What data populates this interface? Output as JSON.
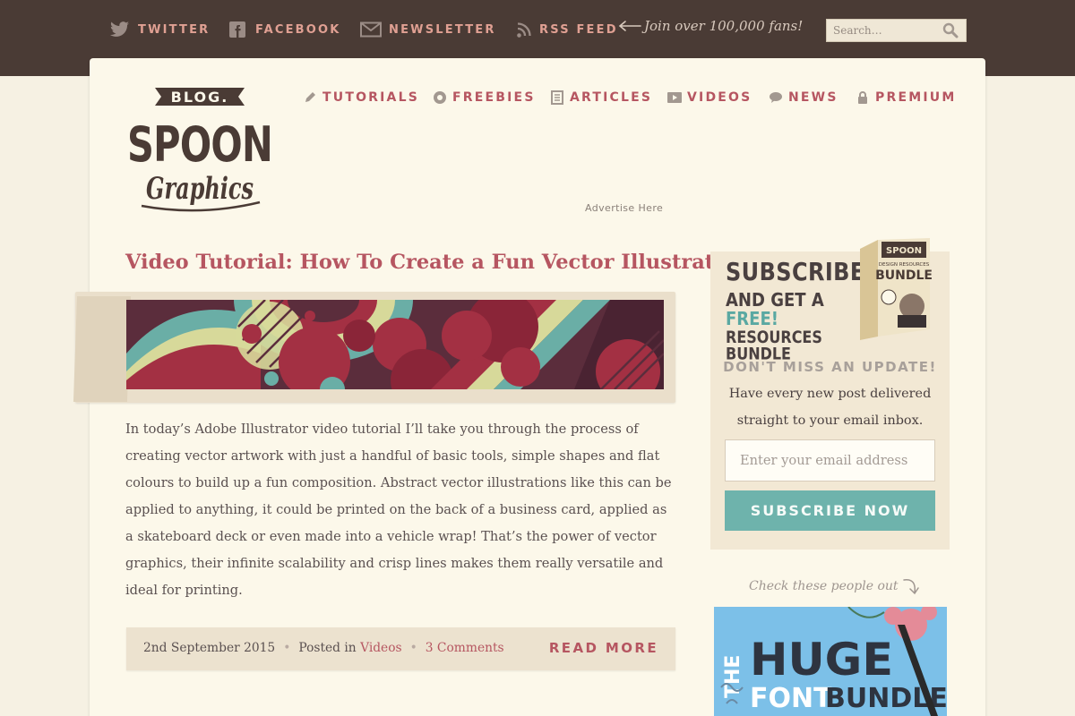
{
  "topbar": {
    "social": [
      {
        "label": "TWITTER",
        "icon": "twitter-icon"
      },
      {
        "label": "FACEBOOK",
        "icon": "facebook-icon"
      },
      {
        "label": "NEWSLETTER",
        "icon": "envelope-icon"
      },
      {
        "label": "RSS FEED",
        "icon": "rss-icon"
      }
    ],
    "fans_note": "Join over 100,000 fans!",
    "search": {
      "placeholder": "Search…"
    }
  },
  "logo": {
    "top": "BLOG.",
    "middle": "SPOON",
    "bottom": "Graphics"
  },
  "nav": [
    {
      "label": "TUTORIALS",
      "icon": "pencil-icon"
    },
    {
      "label": "FREEBIES",
      "icon": "gift-icon"
    },
    {
      "label": "ARTICLES",
      "icon": "document-icon"
    },
    {
      "label": "VIDEOS",
      "icon": "video-icon"
    },
    {
      "label": "NEWS",
      "icon": "speech-bubble-icon"
    },
    {
      "label": "PREMIUM",
      "icon": "lock-icon"
    }
  ],
  "advertise": "Advertise Here",
  "post": {
    "title": "Video Tutorial: How To Create a Fun Vector Illustration",
    "body": "In today’s Adobe Illustrator video tutorial I’ll take you through the process of creating vector artwork with just a handful of basic tools, simple shapes and flat colours to build up a fun composition. Abstract vector illustrations like this can be applied to anything, it could be printed on the back of a business card, applied as a skateboard deck or even made into a vehicle wrap! That’s the power of vector graphics, their infinite scalability and crisp lines makes them really versatile and ideal for printing.",
    "date": "2nd September 2015",
    "posted_in_label": "Posted in",
    "category": "Videos",
    "comments": "3 Comments",
    "read_more": "READ MORE"
  },
  "sidebar": {
    "headline_1": "SUBSCRIBE",
    "headline_2a": "AND GET A ",
    "headline_2b": "FREE!",
    "headline_3": "RESOURCES BUNDLE",
    "bundle_box": {
      "brand": "SPOON",
      "title": "BUNDLE",
      "subtitle": "DESIGN RESOURCES"
    },
    "dont_miss": "DON'T MISS AN UPDATE!",
    "description": "Have every new post delivered straight to your email inbox.",
    "email_placeholder": "Enter your email address",
    "subscribe_button": "SUBSCRIBE NOW",
    "check_note": "Check these people out",
    "ad": {
      "line1": "THE",
      "line2": "HUGE",
      "line3": "FONT",
      "line4": "BUNDLE"
    }
  },
  "colors": {
    "topbar": "#4a3b35",
    "accent": "#b65661",
    "teal": "#6eb3ac",
    "social": "#e0a093"
  }
}
